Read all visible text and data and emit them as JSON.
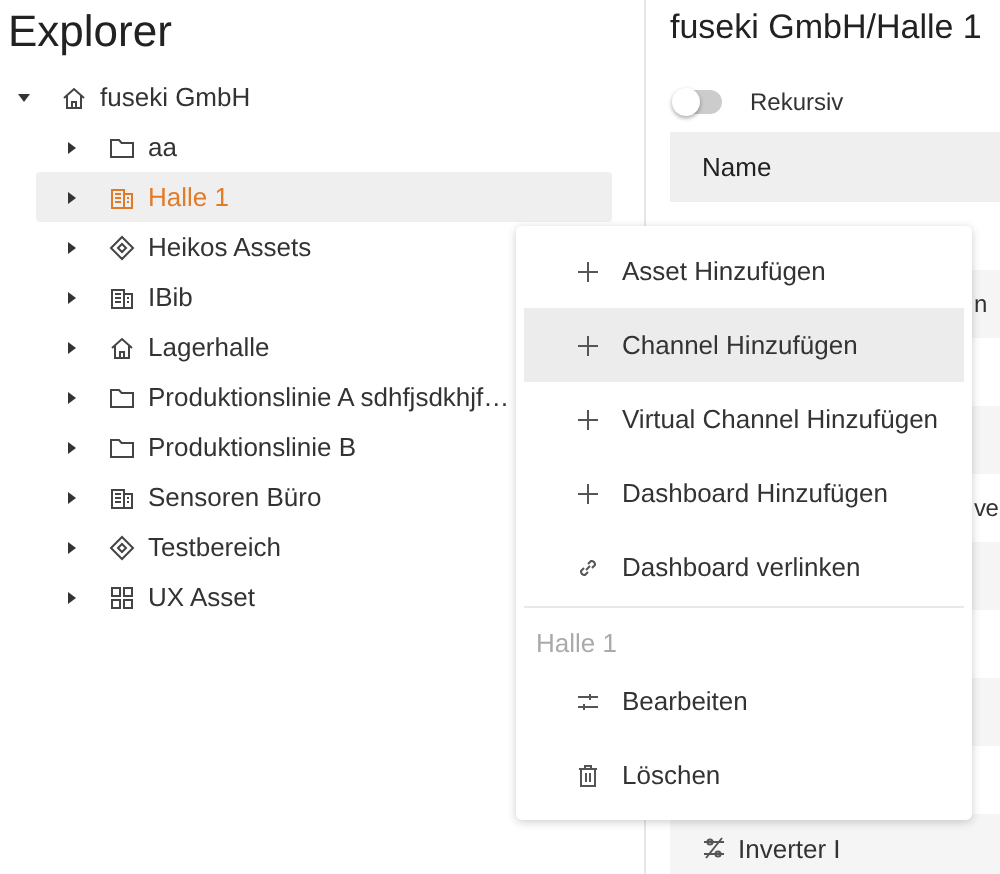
{
  "explorer": {
    "title": "Explorer",
    "tree": [
      {
        "label": "fuseki GmbH",
        "kind": "house",
        "expanded": true,
        "selected": false,
        "children": [
          {
            "label": "aa",
            "kind": "folder",
            "expanded": false,
            "selected": false
          },
          {
            "label": "Halle 1",
            "kind": "building",
            "expanded": false,
            "selected": true
          },
          {
            "label": "Heikos Assets",
            "kind": "diamond",
            "expanded": false,
            "selected": false
          },
          {
            "label": "IBib",
            "kind": "building",
            "expanded": false,
            "selected": false
          },
          {
            "label": "Lagerhalle",
            "kind": "house",
            "expanded": false,
            "selected": false
          },
          {
            "label": "Produktionslinie A sdhfjsdkhjf…",
            "kind": "folder",
            "expanded": false,
            "selected": false
          },
          {
            "label": "Produktionslinie B",
            "kind": "folder",
            "expanded": false,
            "selected": false
          },
          {
            "label": "Sensoren Büro",
            "kind": "building",
            "expanded": false,
            "selected": false
          },
          {
            "label": "Testbereich",
            "kind": "diamond",
            "expanded": false,
            "selected": false
          },
          {
            "label": "UX Asset",
            "kind": "grid",
            "expanded": false,
            "selected": false
          }
        ]
      }
    ]
  },
  "detail": {
    "title": "fuseki GmbH/Halle 1",
    "toggle": {
      "label": "Rekursiv",
      "on": false
    },
    "table": {
      "columns": [
        "Name"
      ],
      "rows": [
        {
          "kind": "blank"
        },
        {
          "kind": "fragment",
          "name": "n"
        },
        {
          "kind": "blank"
        },
        {
          "kind": "blank"
        },
        {
          "kind": "fragment",
          "name": "ve"
        },
        {
          "kind": "blank"
        },
        {
          "kind": "blank"
        },
        {
          "kind": "blank"
        },
        {
          "kind": "blank"
        },
        {
          "kind": "asset",
          "name": "Inverter I"
        }
      ]
    }
  },
  "context_menu": {
    "items": [
      {
        "kind": "add",
        "label": "Asset Hinzufügen",
        "selected": false
      },
      {
        "kind": "add",
        "label": "Channel Hinzufügen",
        "selected": true
      },
      {
        "kind": "add",
        "label": "Virtual Channel Hinzufügen",
        "selected": false
      },
      {
        "kind": "add",
        "label": "Dashboard Hinzufügen",
        "selected": false
      },
      {
        "kind": "link",
        "label": "Dashboard verlinken",
        "selected": false
      }
    ],
    "section": {
      "title": "Halle 1",
      "items": [
        {
          "kind": "edit",
          "label": "Bearbeiten",
          "selected": false
        },
        {
          "kind": "delete",
          "label": "Löschen",
          "selected": false
        }
      ]
    }
  }
}
